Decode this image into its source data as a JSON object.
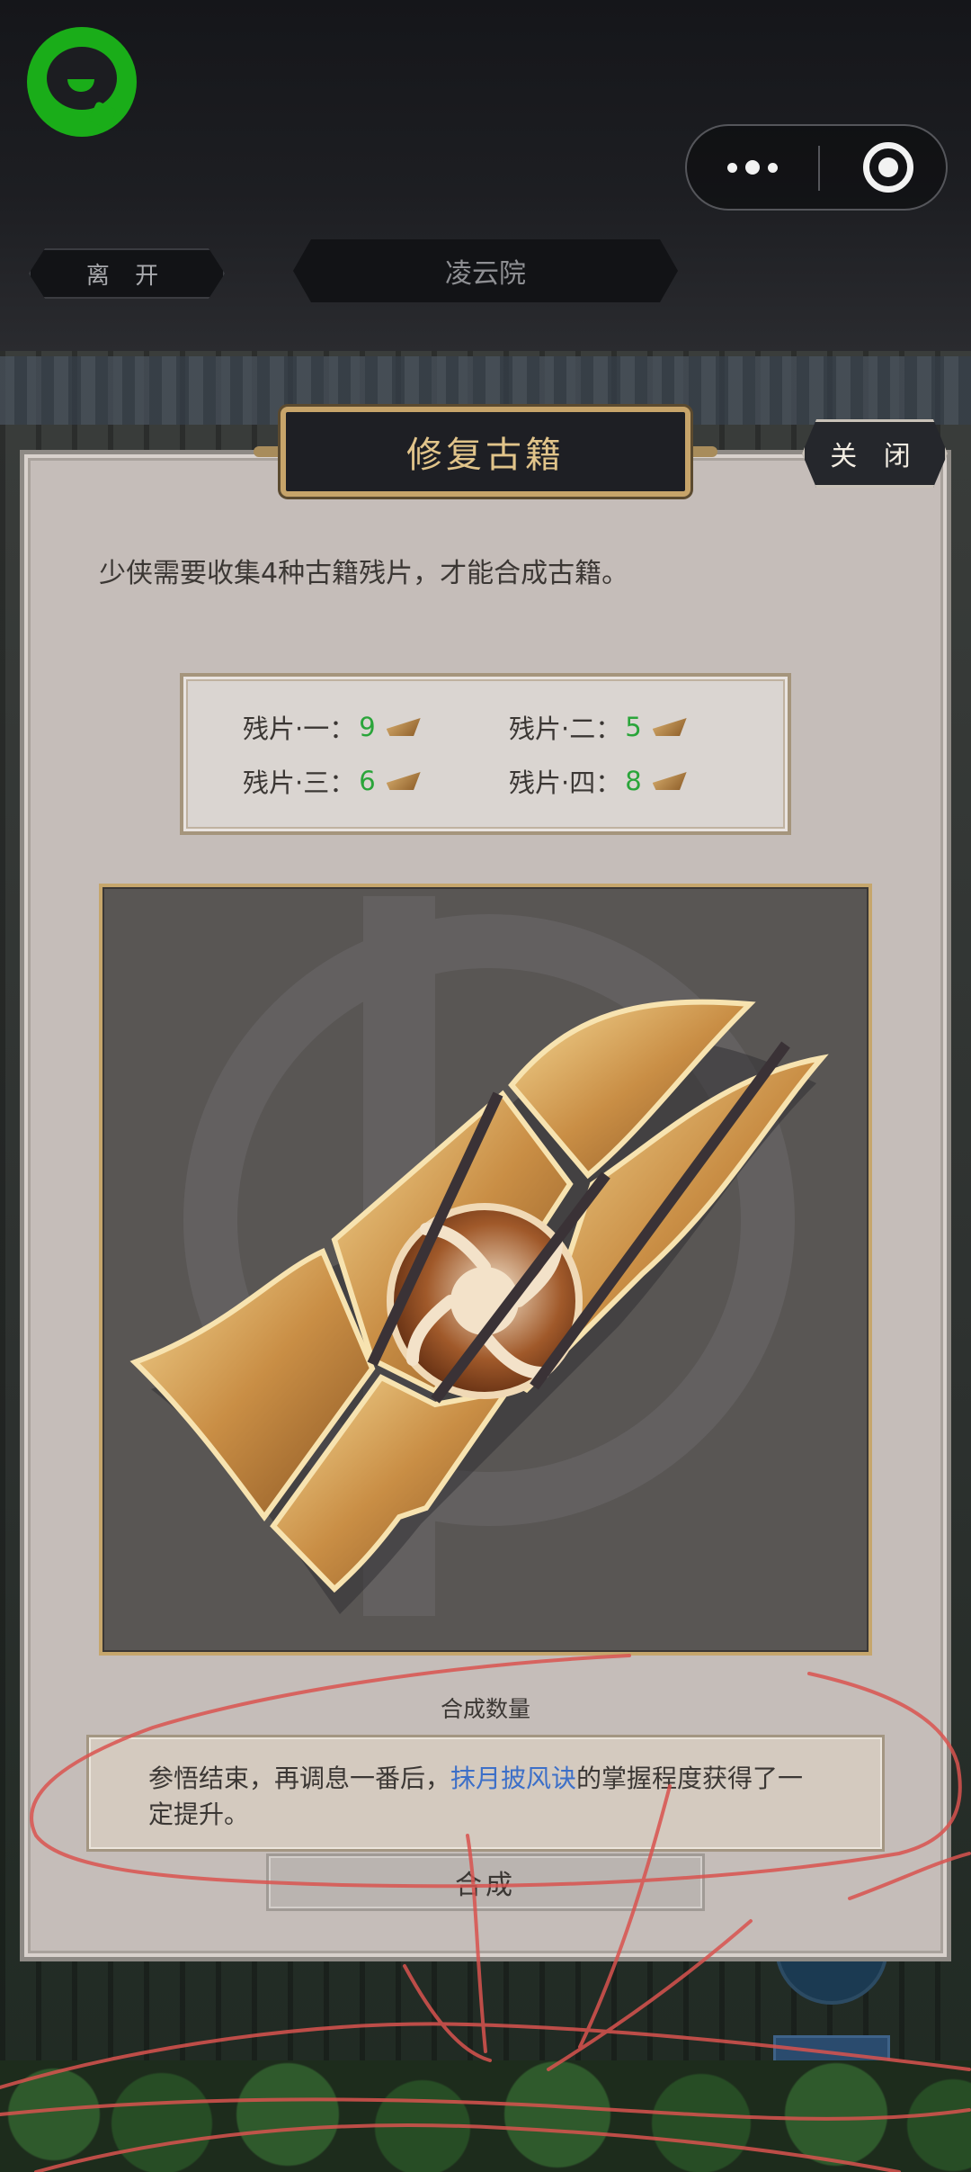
{
  "app_bar": {
    "leave_label": "离 开",
    "location_title": "凌云院"
  },
  "dialog": {
    "title": "修复古籍",
    "close_label": "关 闭",
    "intro": "少侠需要收集4种古籍残片，才能合成古籍。",
    "fragments": [
      {
        "label": "残片·一：",
        "count": "9",
        "icon": "fragment-1-icon"
      },
      {
        "label": "残片·二：",
        "count": "5",
        "icon": "fragment-2-icon"
      },
      {
        "label": "残片·三：",
        "count": "6",
        "icon": "fragment-3-icon"
      },
      {
        "label": "残片·四：",
        "count": "8",
        "icon": "fragment-4-icon"
      }
    ],
    "quantity_label": "合成数量",
    "synthesize_label": "合成"
  },
  "toast": {
    "prefix": "参悟结束，再调息一番后，",
    "skill": "抹月披风诀",
    "suffix": "的掌握程度获得了一定提升。"
  },
  "colors": {
    "accent_gold": "#c7a46a",
    "count_green": "#2aa53a",
    "skill_blue": "#3c6fc8",
    "wechat_green": "#1aad19"
  }
}
